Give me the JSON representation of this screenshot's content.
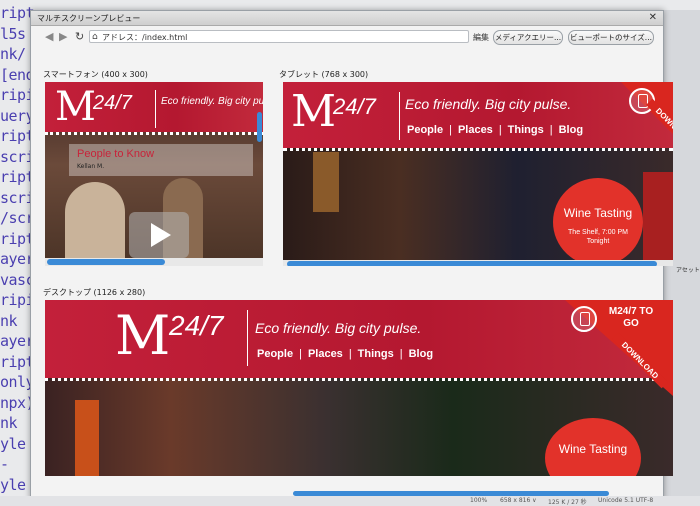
{
  "editor": {
    "code_fragments": [
      "ript",
      "l5s",
      "nk/",
      "[end",
      "ripi",
      "uery",
      "ript",
      "scri",
      "ript",
      "scri",
      "/scr",
      "ript",
      "ayer",
      "vasc",
      "ripi",
      "nk",
      "ayer",
      "ript",
      "only",
      "npx)",
      "nk",
      "yle",
      "-",
      "yle"
    ]
  },
  "window": {
    "title": "マルチスクリーンプレビュー",
    "close_glyph": "✕",
    "address_label": "アドレス：",
    "address_value": "/index.html",
    "edit_label": "編集",
    "media_query_button": "メディアクエリー...",
    "viewport_button": "ビューポートのサイズ..."
  },
  "sections": {
    "smartphone": "スマートフォン (400 x 300)",
    "tablet": "タブレット (768 x 300)",
    "desktop": "デスクトップ (1126 x 280)"
  },
  "site": {
    "logo_number": "24/7",
    "tagline": "Eco friendly. Big city pulse.",
    "nav": [
      "People",
      "Places",
      "Things",
      "Blog"
    ],
    "feature_title": "People to Know",
    "feature_name": "Kellan M.",
    "event_title": "Wine Tasting",
    "event_detail": "The Shelf, 7:00 PM Tonight",
    "promo_title": "M24/7 TO GO",
    "promo_ribbon": "DOWNLOAD"
  },
  "status_bar": {
    "items": [
      "100%",
      "658 x 816 ∨",
      "125 K / 27 秒",
      "Unicode 5.1 UTF-8"
    ]
  },
  "right_panel": {
    "label": "アセット"
  },
  "colors": {
    "brand_red": "#c3203a",
    "scroll_blue": "#3a8ad6"
  }
}
